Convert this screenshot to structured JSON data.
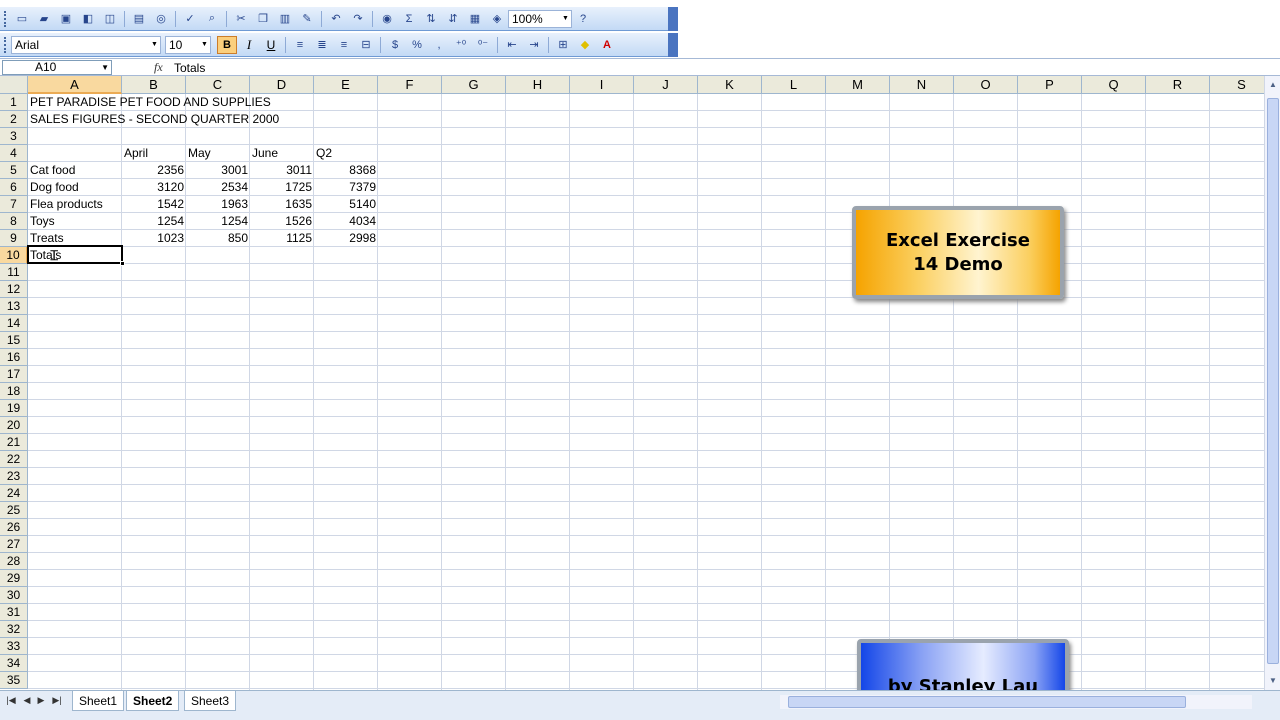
{
  "toolbar": {
    "zoom": "100%",
    "font_name": "Arial",
    "font_size": "10",
    "bold_label": "B",
    "italic_label": "I",
    "underline_label": "U",
    "currency_label": "$",
    "percent_label": "%",
    "comma_label": ",",
    "autosum_label": "Σ"
  },
  "formula_bar": {
    "name_box": "A10",
    "fx_label": "fx",
    "content": "Totals"
  },
  "columns": [
    "A",
    "B",
    "C",
    "D",
    "E",
    "F",
    "G",
    "H",
    "I",
    "J",
    "K",
    "L",
    "M",
    "N",
    "O",
    "P",
    "Q",
    "R",
    "S"
  ],
  "rows": [
    "1",
    "2",
    "3",
    "4",
    "5",
    "6",
    "7",
    "8",
    "9",
    "10",
    "11",
    "12",
    "13",
    "14",
    "15",
    "16",
    "17",
    "18",
    "19",
    "20",
    "21",
    "22",
    "23",
    "24",
    "25",
    "26",
    "27",
    "28",
    "29",
    "30",
    "31",
    "32",
    "33",
    "34",
    "35"
  ],
  "cells": {
    "title1": "PET PARADISE PET FOOD AND SUPPLIES",
    "title2": "SALES FIGURES - SECOND QUARTER 2000",
    "headers": [
      "April",
      "May",
      "June",
      "Q2"
    ],
    "table": [
      {
        "label": "Cat food",
        "values": [
          "2356",
          "3001",
          "3011",
          "8368"
        ]
      },
      {
        "label": "Dog food",
        "values": [
          "3120",
          "2534",
          "1725",
          "7379"
        ]
      },
      {
        "label": "Flea products",
        "values": [
          "1542",
          "1963",
          "1635",
          "5140"
        ]
      },
      {
        "label": "Toys",
        "values": [
          "1254",
          "1254",
          "1526",
          "4034"
        ]
      },
      {
        "label": "Treats",
        "values": [
          "1023",
          "850",
          "1125",
          "2998"
        ]
      }
    ],
    "a10": "Totals"
  },
  "banners": {
    "top": "Excel Exercise 14 Demo",
    "bottom": "by Stanley Lau"
  },
  "sheets": [
    "Sheet1",
    "Sheet2",
    "Sheet3"
  ],
  "active_sheet": "Sheet2",
  "colors": {
    "selected_header": "#f9d99f",
    "toolbar_bg": "#c3daf5"
  }
}
